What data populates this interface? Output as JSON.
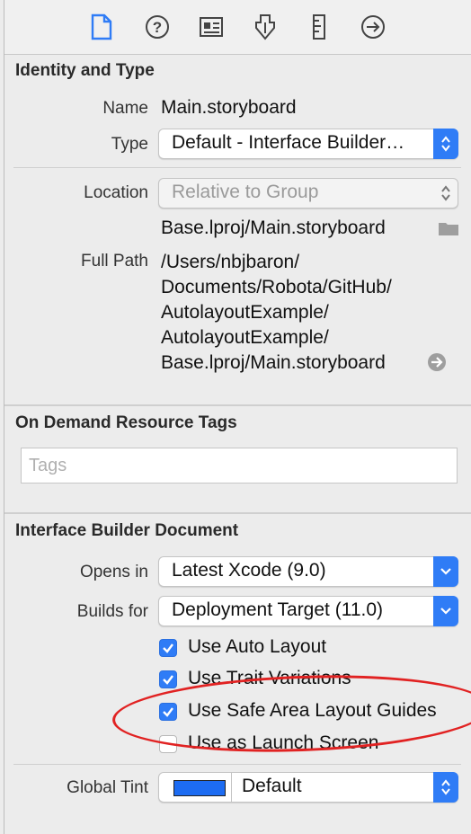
{
  "identity": {
    "title": "Identity and Type",
    "name_label": "Name",
    "name_value": "Main.storyboard",
    "type_label": "Type",
    "type_value": "Default - Interface Builder…",
    "location_label": "Location",
    "location_value": "Relative to Group",
    "location_path": "Base.lproj/Main.storyboard",
    "fullpath_label": "Full Path",
    "fullpath_lines": [
      "/Users/nbjbaron/",
      "Documents/Robota/GitHub/",
      "AutolayoutExample/",
      "AutolayoutExample/",
      "Base.lproj/Main.storyboard"
    ]
  },
  "tags": {
    "title": "On Demand Resource Tags",
    "placeholder": "Tags"
  },
  "ib": {
    "title": "Interface Builder Document",
    "opens_in_label": "Opens in",
    "opens_in_value": "Latest Xcode (9.0)",
    "builds_for_label": "Builds for",
    "builds_for_value": "Deployment Target (11.0)",
    "checkboxes": [
      {
        "label": "Use Auto Layout",
        "checked": true
      },
      {
        "label": "Use Trait Variations",
        "checked": true
      },
      {
        "label": "Use Safe Area Layout Guides",
        "checked": true
      },
      {
        "label": "Use as Launch Screen",
        "checked": false
      }
    ],
    "global_tint_label": "Global Tint",
    "global_tint_value": "Default",
    "tint_color": "#1d6cf2"
  },
  "toolbar": {
    "icons": [
      "file-inspector-icon",
      "quick-help-icon",
      "identity-inspector-icon",
      "attributes-inspector-icon",
      "size-inspector-icon",
      "connections-inspector-icon"
    ],
    "accent_color": "#2f7cf6"
  },
  "annotation_color": "#e12222"
}
